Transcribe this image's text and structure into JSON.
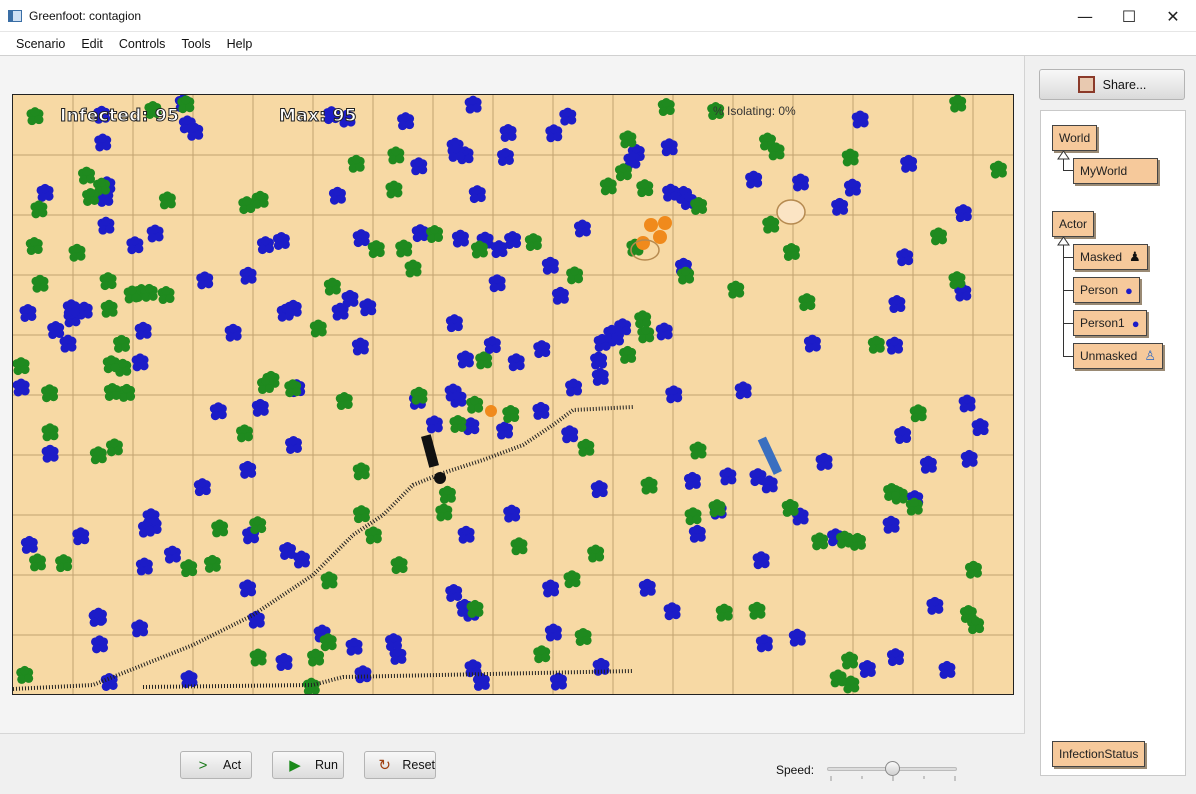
{
  "window": {
    "title": "Greenfoot: contagion",
    "minimize": "—",
    "maximize": "☐",
    "close": "✕"
  },
  "menu": [
    "Scenario",
    "Edit",
    "Controls",
    "Tools",
    "Help"
  ],
  "world": {
    "infected_label": "Infected: 95",
    "max_label": "Max: 95",
    "isolating_label": "% Isolating: 0%"
  },
  "controls": {
    "act_label": "Act",
    "run_label": "Run",
    "reset_label": "Reset",
    "speed_label": "Speed:",
    "speed_value": 0.5
  },
  "sidebar": {
    "share_label": "Share...",
    "classes": {
      "world": "World",
      "myworld": "MyWorld",
      "actor": "Actor",
      "masked": "Masked",
      "person": "Person",
      "person1": "Person1",
      "unmasked": "Unmasked",
      "infection_status": "InfectionStatus"
    }
  },
  "colors": {
    "sand": "#f7d9a4",
    "infected_blue": "#1c1cc8",
    "healthy_green": "#1f8a1f",
    "class_box": "#f6c99b"
  }
}
